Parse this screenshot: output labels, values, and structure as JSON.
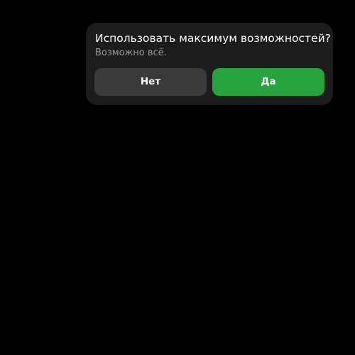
{
  "notification": {
    "title": "Использовать максимум возможностей?",
    "subtitle": "Возможно всё.",
    "buttons": {
      "no_label": "Нет",
      "yes_label": "Да"
    },
    "colors": {
      "background": "#000000",
      "card": "#1c1c1c",
      "no_button": "#3a3a3a",
      "yes_button": "#26a33d",
      "title_text": "#ffffff",
      "subtitle_text": "#9a9a9a"
    }
  }
}
